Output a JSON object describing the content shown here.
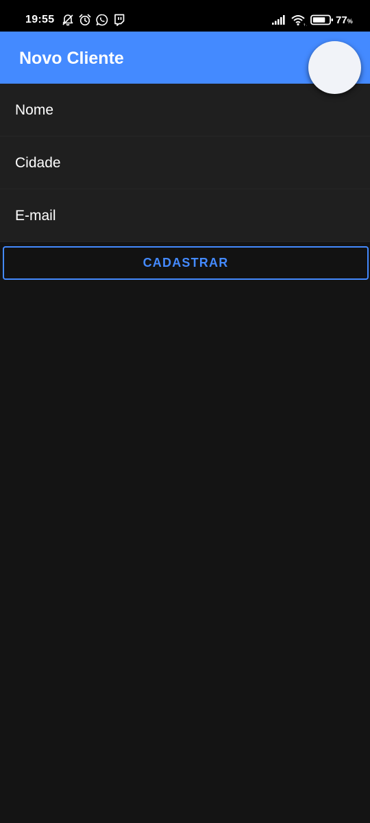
{
  "status_bar": {
    "time": "19:55",
    "battery_percent": "77",
    "battery_unit": "%",
    "icons": [
      "muted-alarm-icon",
      "alarm-icon",
      "whatsapp-icon",
      "twitch-icon",
      "signal-icon",
      "wifi-icon",
      "battery-icon"
    ]
  },
  "app_bar": {
    "title": "Novo Cliente",
    "color": "#448aff"
  },
  "form": {
    "fields": [
      {
        "label": "Nome"
      },
      {
        "label": "Cidade"
      },
      {
        "label": "E-mail"
      }
    ],
    "submit_label": "CADASTRAR"
  },
  "colors": {
    "accent": "#448aff",
    "background": "#141414",
    "field_background": "#1f1f1f"
  }
}
